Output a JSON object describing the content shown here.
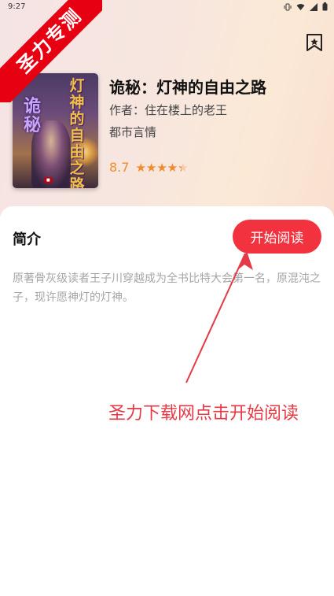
{
  "status_bar": {
    "time": "9:27",
    "icons": [
      "vibrate-icon",
      "wifi-icon",
      "signal-icon",
      "battery-icon"
    ]
  },
  "ribbon": {
    "text": "圣力专测",
    "color": "#e60012"
  },
  "header": {
    "bookmark_icon": "bookmark-star-icon"
  },
  "book": {
    "cover_title_line1": "灯神的自由之路",
    "cover_title_line2": "诡秘",
    "title": "诡秘：灯神的自由之路",
    "author": "作者：住在楼上的老王",
    "category": "都市言情",
    "rating": "8.7",
    "rating_fraction": 0.87,
    "stars_max": 5
  },
  "intro": {
    "heading": "简介",
    "text": "原著骨灰级读者王子川穿越成为全书比特大会第一名，原混沌之子，现许愿神灯的灯神。"
  },
  "actions": {
    "start_reading_label": "开始阅读"
  },
  "annotation": {
    "promo_text": "圣力下载网点击开始阅读",
    "color": "#e63946"
  },
  "colors": {
    "accent": "#f2323f",
    "rating": "#f08c2c",
    "text_muted": "#a5a5a5"
  }
}
